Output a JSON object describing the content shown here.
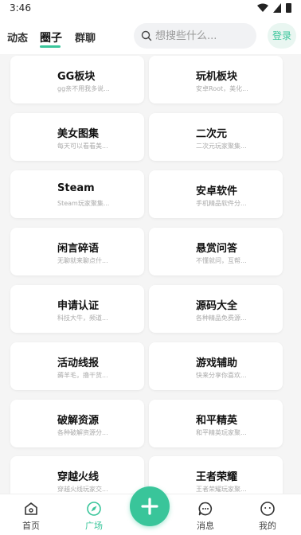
{
  "status_bar": {
    "time": "3:46"
  },
  "header": {
    "tabs": [
      {
        "label": "动态",
        "active": false
      },
      {
        "label": "圈子",
        "active": true
      },
      {
        "label": "群聊",
        "active": false
      }
    ],
    "search_placeholder": "想搜些什么...",
    "login_label": "登录"
  },
  "colors": {
    "accent": "#39c59a",
    "background": "#f5f5f5",
    "card": "#ffffff"
  },
  "cards": [
    {
      "title": "GG板块",
      "desc": "gg亲不用我多说..."
    },
    {
      "title": "玩机板块",
      "desc": "安卓Root，美化..."
    },
    {
      "title": "美女图集",
      "desc": "每天可以看看美..."
    },
    {
      "title": "二次元",
      "desc": "二次元玩家聚集..."
    },
    {
      "title": "Steam",
      "desc": "Steam玩家聚集..."
    },
    {
      "title": "安卓软件",
      "desc": "手机精品软件分..."
    },
    {
      "title": "闲言碎语",
      "desc": "无聊就来聊点什..."
    },
    {
      "title": "悬赏问答",
      "desc": "不懂就问，互帮..."
    },
    {
      "title": "申请认证",
      "desc": "科技大牛，频道..."
    },
    {
      "title": "源码大全",
      "desc": "各种精品免费源..."
    },
    {
      "title": "活动线报",
      "desc": "薅羊毛，撸干货..."
    },
    {
      "title": "游戏辅助",
      "desc": "快来分享你喜欢..."
    },
    {
      "title": "破解资源",
      "desc": "各种破解资源分..."
    },
    {
      "title": "和平精英",
      "desc": "和平精英玩家聚..."
    },
    {
      "title": "穿越火线",
      "desc": "穿越火线玩家交..."
    },
    {
      "title": "王者荣耀",
      "desc": "王者荣耀玩家聚..."
    }
  ],
  "bottom_nav": {
    "items": [
      {
        "label": "首页",
        "icon": "home-icon"
      },
      {
        "label": "广场",
        "icon": "compass-icon",
        "active": true
      },
      {
        "label": "消息",
        "icon": "chat-icon"
      },
      {
        "label": "我的",
        "icon": "profile-icon"
      }
    ],
    "fab_icon": "plus-icon"
  }
}
